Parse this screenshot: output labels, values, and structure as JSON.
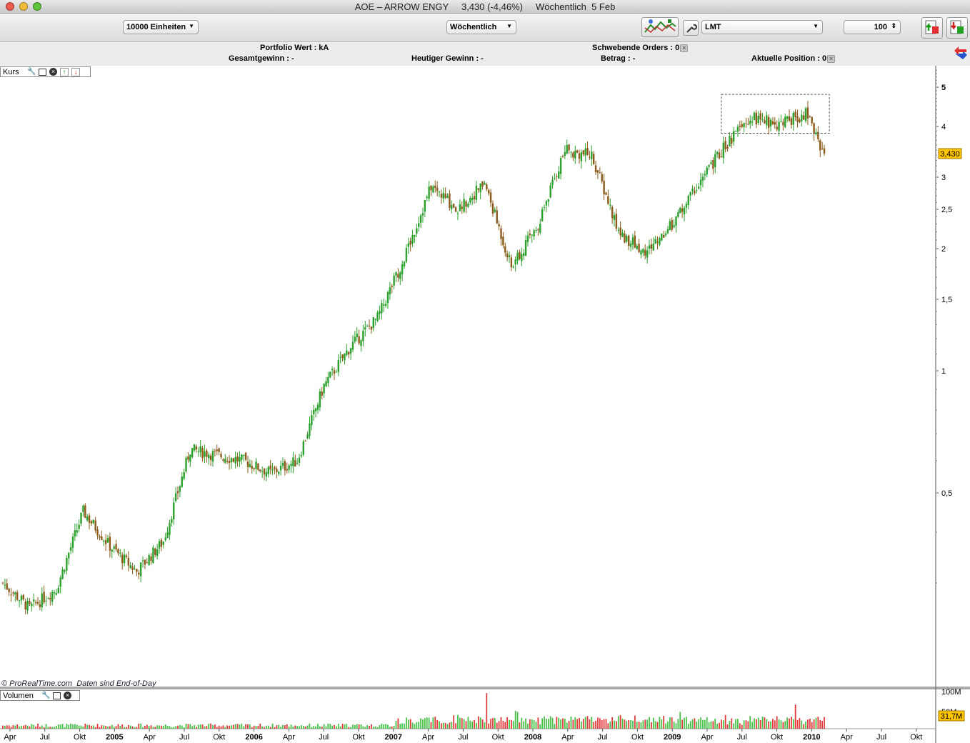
{
  "window": {
    "title": "AOE – ARROW ENGY     3,430 (-4,46%)     Wöchentlich  5 Feb"
  },
  "toolbar": {
    "units_select": "10000 Einheiten",
    "period_select": "Wöchentlich",
    "order_type_select": "LMT",
    "quantity_value": "100"
  },
  "info": {
    "portfolio_wert": "Portfolio Wert : kA",
    "schwebende_orders": "Schwebende Orders : 0",
    "gesamtgewinn": "Gesamtgewinn : -",
    "heutiger_gewinn": "Heutiger Gewinn : -",
    "betrag": "Betrag : -",
    "aktuelle_position": "Aktuelle Position : 0"
  },
  "price_panel": {
    "label": "Kurs",
    "footer": "© ProRealTime.com  Daten sind End-of-Day",
    "last_price_tag": "3,430"
  },
  "volume_panel": {
    "label": "Volumen",
    "axis_top": "100M",
    "axis_mid": "50M",
    "last_volume_tag": "31,7M"
  },
  "colors": {
    "up": "#2ca02c",
    "down": "#8b5a1a",
    "tag": "#ffc400",
    "vol_up": "#48c048",
    "vol_down": "#e03a3a"
  },
  "chart_data": {
    "type": "candlestick",
    "scale": "log",
    "y_ticks": [
      "5",
      "4",
      "3",
      "2,5",
      "2",
      "1,5",
      "1",
      "0,5"
    ],
    "x_ticks": [
      "Apr",
      "Jul",
      "Okt",
      "2005",
      "Apr",
      "Jul",
      "Okt",
      "2006",
      "Apr",
      "Jul",
      "Okt",
      "2007",
      "Apr",
      "Jul",
      "Okt",
      "2008",
      "Apr",
      "Jul",
      "Okt",
      "2009",
      "Apr",
      "Jul",
      "Okt",
      "2010",
      "Apr",
      "Jul",
      "Okt"
    ],
    "price_path": [
      [
        0,
        0.3
      ],
      [
        13,
        0.26
      ],
      [
        26,
        0.29
      ],
      [
        39,
        0.45
      ],
      [
        52,
        0.37
      ],
      [
        65,
        0.32
      ],
      [
        78,
        0.38
      ],
      [
        91,
        0.64
      ],
      [
        104,
        0.62
      ],
      [
        117,
        0.6
      ],
      [
        130,
        0.56
      ],
      [
        143,
        0.6
      ],
      [
        156,
        0.92
      ],
      [
        169,
        1.15
      ],
      [
        182,
        1.35
      ],
      [
        195,
        1.9
      ],
      [
        208,
        2.85
      ],
      [
        221,
        2.5
      ],
      [
        234,
        2.9
      ],
      [
        247,
        1.8
      ],
      [
        260,
        2.3
      ],
      [
        273,
        3.5
      ],
      [
        286,
        3.4
      ],
      [
        299,
        2.2
      ],
      [
        312,
        1.95
      ],
      [
        325,
        2.3
      ],
      [
        338,
        2.9
      ],
      [
        351,
        3.6
      ],
      [
        364,
        4.2
      ],
      [
        377,
        4.05
      ],
      [
        390,
        4.3
      ],
      [
        399,
        3.43
      ]
    ],
    "last_close": 3.43,
    "change_pct": -4.46
  }
}
